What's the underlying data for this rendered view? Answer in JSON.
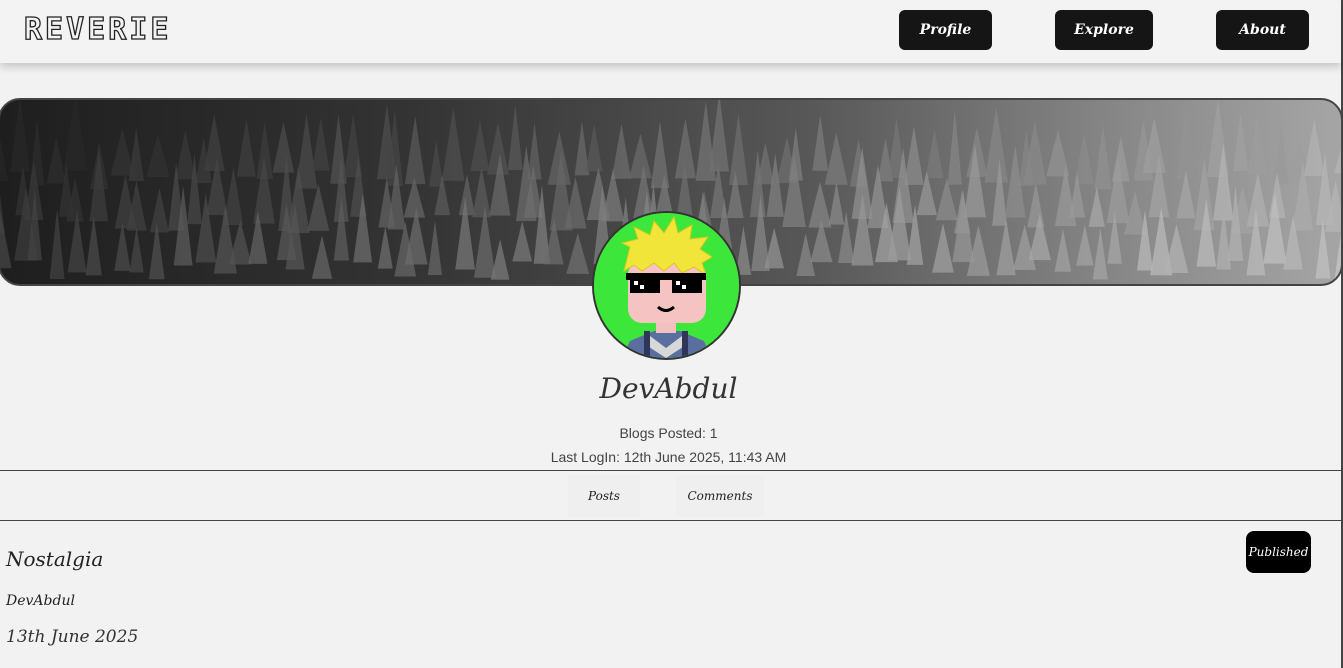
{
  "header": {
    "logo": "REVERIE",
    "nav": {
      "profile": "Profile",
      "explore": "Explore",
      "about": "About"
    }
  },
  "profile": {
    "username": "DevAbdul",
    "blogs_posted": "Blogs Posted: 1",
    "last_login": "Last LogIn: 12th June 2025, 11:43 AM",
    "avatar_icon": "pixel-sunglasses-avatar-icon"
  },
  "tabs": {
    "posts": "Posts",
    "comments": "Comments"
  },
  "posts": [
    {
      "title": "Nostalgia",
      "author": "DevAbdul",
      "date": "13th June 2025",
      "status": "Published"
    }
  ],
  "colors": {
    "nav_button_bg": "#151515",
    "avatar_bg": "#3de63a",
    "page_bg": "#f2f2f2"
  }
}
